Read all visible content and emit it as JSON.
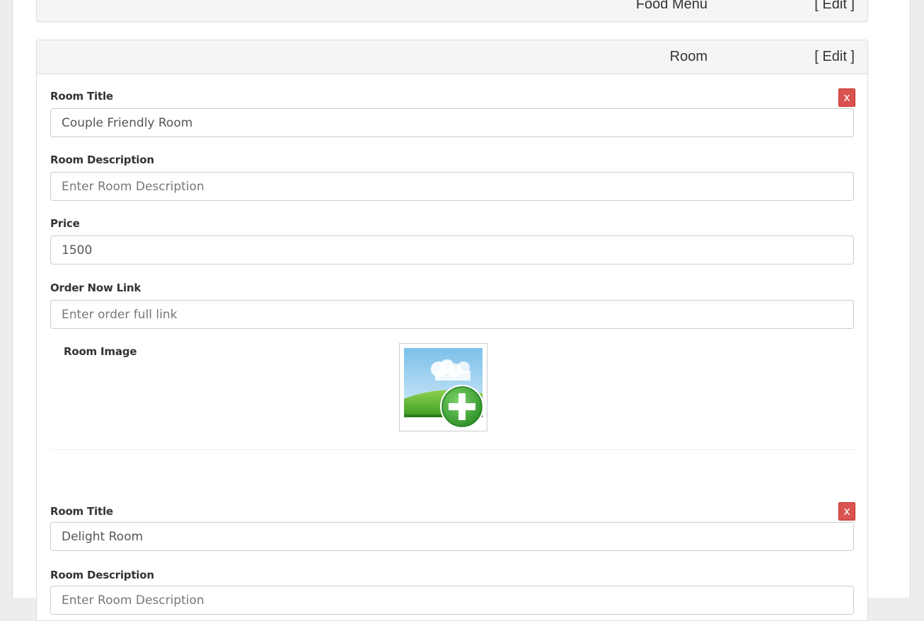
{
  "panels": {
    "food_menu": {
      "title": "Food Menu",
      "edit_label": "[ Edit ]"
    },
    "room": {
      "title": "Room",
      "edit_label": "[ Edit ]"
    }
  },
  "rooms": [
    {
      "remove_label": "x",
      "title_label": "Room Title",
      "title_value": "Couple Friendly Room",
      "description_label": "Room Description",
      "description_placeholder": "Enter Room Description",
      "price_label": "Price",
      "price_value": "1500",
      "order_link_label": "Order Now Link",
      "order_link_placeholder": "Enter order full link",
      "image_label": "Room Image",
      "image_icon": "add-image-icon"
    },
    {
      "remove_label": "x",
      "title_label": "Room Title",
      "title_value": "Delight Room",
      "description_label": "Room Description",
      "description_placeholder": "Enter Room Description"
    }
  ],
  "colors": {
    "remove_button": "#d9534f",
    "panel_heading": "#f5f5f5",
    "add_icon_green": "#3aa935"
  }
}
